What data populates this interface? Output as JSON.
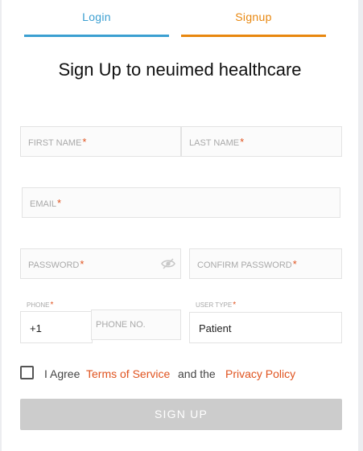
{
  "tabs": {
    "login": "Login",
    "signup": "Signup"
  },
  "title": "Sign Up to neuimed healthcare",
  "form": {
    "first_name": {
      "placeholder": "FIRST NAME",
      "required": "*"
    },
    "last_name": {
      "placeholder": "LAST NAME",
      "required": "*"
    },
    "email": {
      "placeholder": "EMAIL",
      "required": "*"
    },
    "password": {
      "placeholder": "PASSWORD",
      "required": "*"
    },
    "confirm_password": {
      "placeholder": "CONFIRM PASSWORD",
      "required": "*"
    },
    "phone": {
      "label": "PHONE",
      "required": "*",
      "country_code": "+1",
      "placeholder": "PHONE NO."
    },
    "user_type": {
      "label": "USER TYPE",
      "required": "*",
      "value": "Patient"
    }
  },
  "agreement": {
    "prefix": "I Agree",
    "terms_link": "Terms of Service",
    "middle": "and the",
    "privacy_link": "Privacy Policy",
    "checked": false
  },
  "submit_label": "SIGN UP",
  "colors": {
    "login_accent": "#3b9fd1",
    "signup_accent": "#e8870f",
    "required_mark": "#e0531f",
    "button_disabled": "#cccccc"
  },
  "icons": {
    "password_visibility": "eye-icon"
  }
}
